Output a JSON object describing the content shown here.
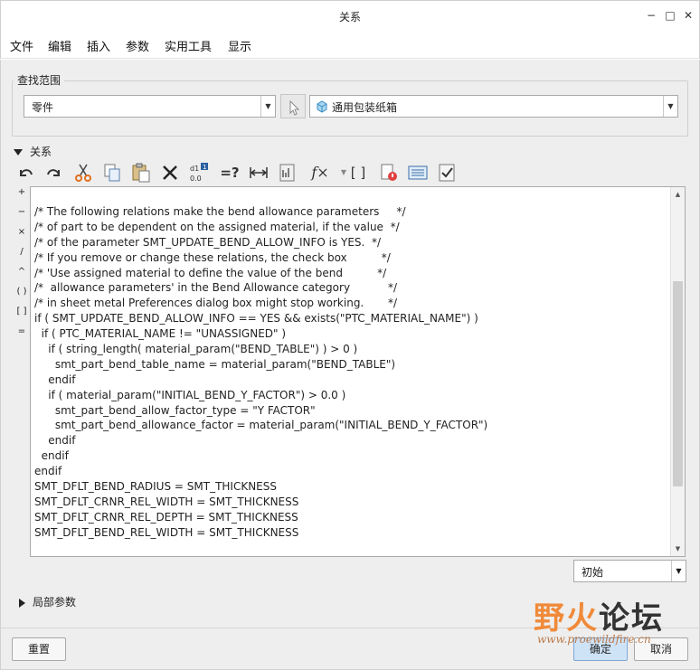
{
  "window": {
    "title": "关系",
    "buttons": {
      "minimize": "−",
      "maximize": "□",
      "close": "✕"
    }
  },
  "menu": [
    "文件",
    "编辑",
    "插入",
    "参数",
    "实用工具",
    "显示"
  ],
  "lookup": {
    "legend": "查找范围",
    "scope_value": "零件",
    "model_value": "通用包装纸箱"
  },
  "relations": {
    "header": "关系",
    "toolbar_icons": [
      "undo-icon",
      "redo-icon",
      "cut-icon",
      "copy-icon",
      "paste-icon",
      "delete-icon",
      "switch-units-icon",
      "evaluate-icon",
      "dimension-icon",
      "sort-icon",
      "function-icon",
      "parentheses-icon",
      "verify-icon",
      "show-dims-icon",
      "checklist-icon"
    ],
    "toolbar_text": {
      "evaluate": "=?",
      "function": "f×",
      "parentheses": "[ ]"
    },
    "operators": [
      "+",
      "−",
      "×",
      "/",
      "^",
      "( )",
      "[ ]",
      "="
    ],
    "lines": [
      "/* The following relations make the bend allowance parameters     */",
      "/* of part to be dependent on the assigned material, if the value  */",
      "/* of the parameter SMT_UPDATE_BEND_ALLOW_INFO is YES.  */",
      "/* If you remove or change these relations, the check box          */",
      "/* 'Use assigned material to define the value of the bend          */",
      "/*  allowance parameters' in the Bend Allowance category           */",
      "/* in sheet metal Preferences dialog box might stop working.       */",
      "if ( SMT_UPDATE_BEND_ALLOW_INFO == YES && exists(\"PTC_MATERIAL_NAME\") )",
      "  if ( PTC_MATERIAL_NAME != \"UNASSIGNED\" )",
      "    if ( string_length( material_param(\"BEND_TABLE\") ) > 0 )",
      "      smt_part_bend_table_name = material_param(\"BEND_TABLE\")",
      "    endif",
      "    if ( material_param(\"INITIAL_BEND_Y_FACTOR\") > 0.0 )",
      "      smt_part_bend_allow_factor_type = \"Y FACTOR\"",
      "      smt_part_bend_allowance_factor = material_param(\"INITIAL_BEND_Y_FACTOR\")",
      "    endif",
      "  endif",
      "endif",
      "SMT_DFLT_BEND_RADIUS = SMT_THICKNESS",
      "SMT_DFLT_CRNR_REL_WIDTH = SMT_THICKNESS",
      "SMT_DFLT_CRNR_REL_DEPTH = SMT_THICKNESS",
      "SMT_DFLT_BEND_REL_WIDTH = SMT_THICKNESS"
    ],
    "state_value": "初始"
  },
  "local_params": {
    "header": "局部参数"
  },
  "footer": {
    "reset": "重置",
    "ok": "确定",
    "cancel": "取消"
  },
  "watermark": {
    "text_a": "野火",
    "text_b": "论坛",
    "url": "www.proewildfire.cn"
  },
  "colors": {
    "accent": "#f08a3a",
    "panel": "#eeeeee",
    "ok_button": "#cfe3f7"
  }
}
